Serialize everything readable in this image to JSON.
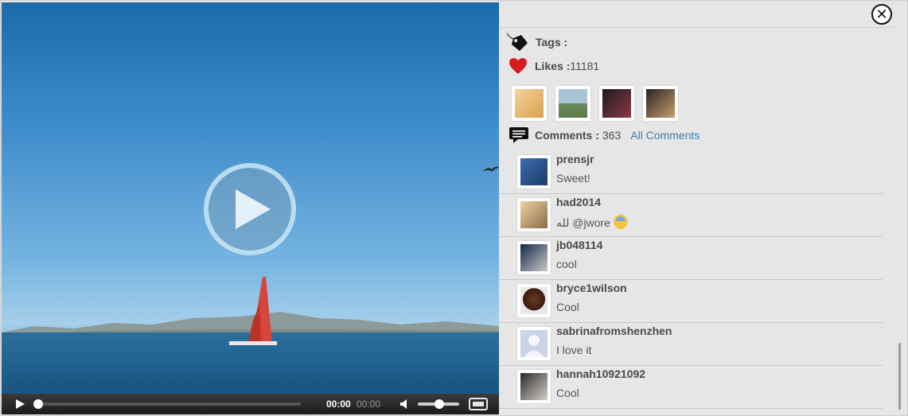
{
  "video": {
    "current_time": "00:00",
    "total_time": "00:00"
  },
  "side": {
    "tags_label": "Tags :",
    "likes_label": "Likes :",
    "likes_count": "11181",
    "comments_label": "Comments :",
    "comments_count": "363",
    "all_comments_link": "All Comments"
  },
  "likers": [
    {
      "color": "#e8c27a"
    },
    {
      "color": "#8fa7a0"
    },
    {
      "color": "#3a2a2e"
    },
    {
      "color": "#5a4a3a"
    }
  ],
  "comments": [
    {
      "user": "prensjr",
      "text": "Sweet!",
      "avatar_color": "#2e5c9a"
    },
    {
      "user": "had2014",
      "text": "لله @jwore",
      "avatar_color": "#d9a35a",
      "emoji": "fearful-face"
    },
    {
      "user": "jb048114",
      "text": "cool",
      "avatar_color": "#1d3b66"
    },
    {
      "user": "bryce1wilson",
      "text": "Cool",
      "avatar_color": "#4a2b1c"
    },
    {
      "user": "sabrinafromshenzhen",
      "text": "I love it",
      "avatar_color": "#c9d4e6"
    },
    {
      "user": "hannah10921092",
      "text": "Cool",
      "avatar_color": "#3d3d3d"
    }
  ],
  "icons": {
    "tag": "tag-icon",
    "heart": "heart-icon",
    "comment": "comment-icon",
    "close": "close-icon"
  },
  "colors": {
    "link": "#3a7fb5",
    "panel_bg": "#e6e6e6"
  }
}
